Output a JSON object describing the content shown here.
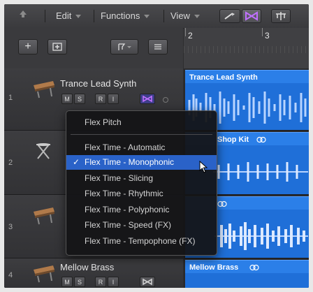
{
  "toolbar": {
    "back_icon": "up-arrow-icon",
    "edit_label": "Edit",
    "functions_label": "Functions",
    "view_label": "View",
    "tool_icons": [
      "catch-playhead-icon",
      "flex-view-icon",
      "snap-icon"
    ]
  },
  "header": {
    "add_icon": "plus-icon",
    "global_tracks_icon": "global-tracks-icon",
    "filter_icon": "filter-icon",
    "list_icon": "list-icon"
  },
  "ruler": {
    "bars": [
      "2",
      "3"
    ]
  },
  "tracks": [
    {
      "number": "1",
      "name": "Trance Lead Synth",
      "buttons": [
        "M",
        "S",
        "R",
        "I"
      ],
      "flex_on": true,
      "region_title": "Trance Lead Synth"
    },
    {
      "number": "2",
      "name": "",
      "buttons": [],
      "flex_on": false,
      "region_title": "Shop Kit"
    },
    {
      "number": "3",
      "name": "",
      "buttons": [],
      "flex_on": false,
      "region_title": ""
    },
    {
      "number": "4",
      "name": "Mellow Brass",
      "buttons": [
        "M",
        "S",
        "R",
        "I"
      ],
      "flex_on": false,
      "region_title": "Mellow Brass"
    }
  ],
  "flex_menu": {
    "items": [
      {
        "label": "Flex Pitch",
        "selected": false
      },
      {
        "label": "Flex Time - Automatic",
        "selected": false
      },
      {
        "label": "Flex Time - Monophonic",
        "selected": true
      },
      {
        "label": "Flex Time - Slicing",
        "selected": false
      },
      {
        "label": "Flex Time - Rhythmic",
        "selected": false
      },
      {
        "label": "Flex Time - Polyphonic",
        "selected": false
      },
      {
        "label": "Flex Time - Speed (FX)",
        "selected": false
      },
      {
        "label": "Flex Time - Tempophone (FX)",
        "selected": false
      }
    ],
    "check_mark": "✓"
  },
  "colors": {
    "region_blue": "#1f6fd8",
    "menu_highlight": "#2a62c8",
    "flex_purple": "#c070ff"
  }
}
